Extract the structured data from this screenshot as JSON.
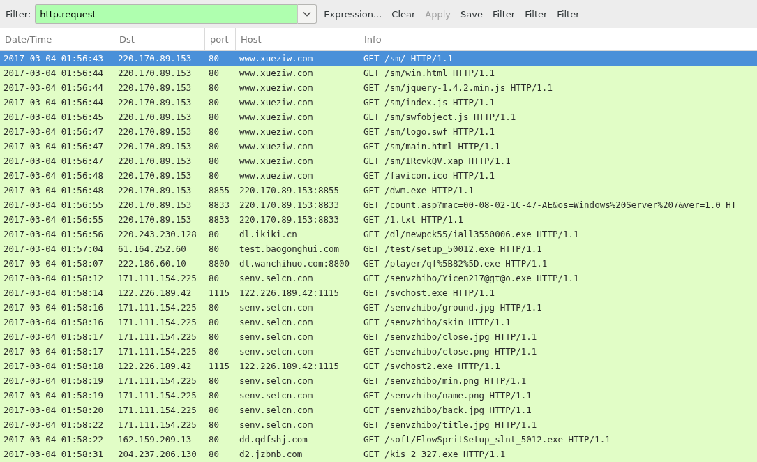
{
  "filter_bar": {
    "label": "Filter:",
    "value": "http.request",
    "valid": true,
    "buttons": [
      {
        "label": "Expression...",
        "disabled": false
      },
      {
        "label": "Clear",
        "disabled": false
      },
      {
        "label": "Apply",
        "disabled": true
      },
      {
        "label": "Save",
        "disabled": false
      },
      {
        "label": "Filter",
        "disabled": false
      },
      {
        "label": "Filter",
        "disabled": false
      },
      {
        "label": "Filter",
        "disabled": false
      }
    ]
  },
  "table": {
    "columns": [
      "Date/Time",
      "Dst",
      "port",
      "Host",
      "Info"
    ],
    "rows": [
      {
        "selected": true,
        "cells": [
          "2017-03-04 01:56:43",
          "220.170.89.153",
          "80",
          "www.xueziw.com",
          "GET /sm/ HTTP/1.1"
        ]
      },
      {
        "selected": false,
        "cells": [
          "2017-03-04 01:56:44",
          "220.170.89.153",
          "80",
          "www.xueziw.com",
          "GET /sm/win.html HTTP/1.1"
        ]
      },
      {
        "selected": false,
        "cells": [
          "2017-03-04 01:56:44",
          "220.170.89.153",
          "80",
          "www.xueziw.com",
          "GET /sm/jquery-1.4.2.min.js HTTP/1.1"
        ]
      },
      {
        "selected": false,
        "cells": [
          "2017-03-04 01:56:44",
          "220.170.89.153",
          "80",
          "www.xueziw.com",
          "GET /sm/index.js HTTP/1.1"
        ]
      },
      {
        "selected": false,
        "cells": [
          "2017-03-04 01:56:45",
          "220.170.89.153",
          "80",
          "www.xueziw.com",
          "GET /sm/swfobject.js HTTP/1.1"
        ]
      },
      {
        "selected": false,
        "cells": [
          "2017-03-04 01:56:47",
          "220.170.89.153",
          "80",
          "www.xueziw.com",
          "GET /sm/logo.swf HTTP/1.1"
        ]
      },
      {
        "selected": false,
        "cells": [
          "2017-03-04 01:56:47",
          "220.170.89.153",
          "80",
          "www.xueziw.com",
          "GET /sm/main.html HTTP/1.1"
        ]
      },
      {
        "selected": false,
        "cells": [
          "2017-03-04 01:56:47",
          "220.170.89.153",
          "80",
          "www.xueziw.com",
          "GET /sm/IRcvkQV.xap HTTP/1.1"
        ]
      },
      {
        "selected": false,
        "cells": [
          "2017-03-04 01:56:48",
          "220.170.89.153",
          "80",
          "www.xueziw.com",
          "GET /favicon.ico HTTP/1.1"
        ]
      },
      {
        "selected": false,
        "cells": [
          "2017-03-04 01:56:48",
          "220.170.89.153",
          "8855",
          "220.170.89.153:8855",
          "GET /dwm.exe HTTP/1.1"
        ]
      },
      {
        "selected": false,
        "cells": [
          "2017-03-04 01:56:55",
          "220.170.89.153",
          "8833",
          "220.170.89.153:8833",
          "GET /count.asp?mac=00-08-02-1C-47-AE&os=Windows%20Server%207&ver=1.0 HT"
        ]
      },
      {
        "selected": false,
        "cells": [
          "2017-03-04 01:56:55",
          "220.170.89.153",
          "8833",
          "220.170.89.153:8833",
          "GET /1.txt HTTP/1.1"
        ]
      },
      {
        "selected": false,
        "cells": [
          "2017-03-04 01:56:56",
          "220.243.230.128",
          "80",
          "dl.ikiki.cn",
          "GET /dl/newpck55/iall3550006.exe HTTP/1.1"
        ]
      },
      {
        "selected": false,
        "cells": [
          "2017-03-04 01:57:04",
          "61.164.252.60",
          "80",
          "test.baogonghui.com",
          "GET /test/setup_50012.exe HTTP/1.1"
        ]
      },
      {
        "selected": false,
        "cells": [
          "2017-03-04 01:58:07",
          "222.186.60.10",
          "8800",
          "dl.wanchihuo.com:8800",
          "GET /player/qf%5B82%5D.exe HTTP/1.1"
        ]
      },
      {
        "selected": false,
        "cells": [
          "2017-03-04 01:58:12",
          "171.111.154.225",
          "80",
          "senv.selcn.com",
          "GET /senvzhibo/Yicen217@gt@o.exe HTTP/1.1"
        ]
      },
      {
        "selected": false,
        "cells": [
          "2017-03-04 01:58:14",
          "122.226.189.42",
          "1115",
          "122.226.189.42:1115",
          "GET /svchost.exe HTTP/1.1"
        ]
      },
      {
        "selected": false,
        "cells": [
          "2017-03-04 01:58:16",
          "171.111.154.225",
          "80",
          "senv.selcn.com",
          "GET /senvzhibo/ground.jpg HTTP/1.1"
        ]
      },
      {
        "selected": false,
        "cells": [
          "2017-03-04 01:58:16",
          "171.111.154.225",
          "80",
          "senv.selcn.com",
          "GET /senvzhibo/skin HTTP/1.1"
        ]
      },
      {
        "selected": false,
        "cells": [
          "2017-03-04 01:58:17",
          "171.111.154.225",
          "80",
          "senv.selcn.com",
          "GET /senvzhibo/close.jpg HTTP/1.1"
        ]
      },
      {
        "selected": false,
        "cells": [
          "2017-03-04 01:58:17",
          "171.111.154.225",
          "80",
          "senv.selcn.com",
          "GET /senvzhibo/close.png HTTP/1.1"
        ]
      },
      {
        "selected": false,
        "cells": [
          "2017-03-04 01:58:18",
          "122.226.189.42",
          "1115",
          "122.226.189.42:1115",
          "GET /svchost2.exe HTTP/1.1"
        ]
      },
      {
        "selected": false,
        "cells": [
          "2017-03-04 01:58:19",
          "171.111.154.225",
          "80",
          "senv.selcn.com",
          "GET /senvzhibo/min.png HTTP/1.1"
        ]
      },
      {
        "selected": false,
        "cells": [
          "2017-03-04 01:58:19",
          "171.111.154.225",
          "80",
          "senv.selcn.com",
          "GET /senvzhibo/name.png HTTP/1.1"
        ]
      },
      {
        "selected": false,
        "cells": [
          "2017-03-04 01:58:20",
          "171.111.154.225",
          "80",
          "senv.selcn.com",
          "GET /senvzhibo/back.jpg HTTP/1.1"
        ]
      },
      {
        "selected": false,
        "cells": [
          "2017-03-04 01:58:22",
          "171.111.154.225",
          "80",
          "senv.selcn.com",
          "GET /senvzhibo/title.jpg HTTP/1.1"
        ]
      },
      {
        "selected": false,
        "cells": [
          "2017-03-04 01:58:22",
          "162.159.209.13",
          "80",
          "dd.qdfshj.com",
          "GET /soft/FlowSpritSetup_slnt_5012.exe HTTP/1.1"
        ]
      },
      {
        "selected": false,
        "cells": [
          "2017-03-04 01:58:31",
          "204.237.206.130",
          "80",
          "d2.jzbnb.com",
          "GET /kis_2_327.exe HTTP/1.1"
        ]
      }
    ]
  }
}
